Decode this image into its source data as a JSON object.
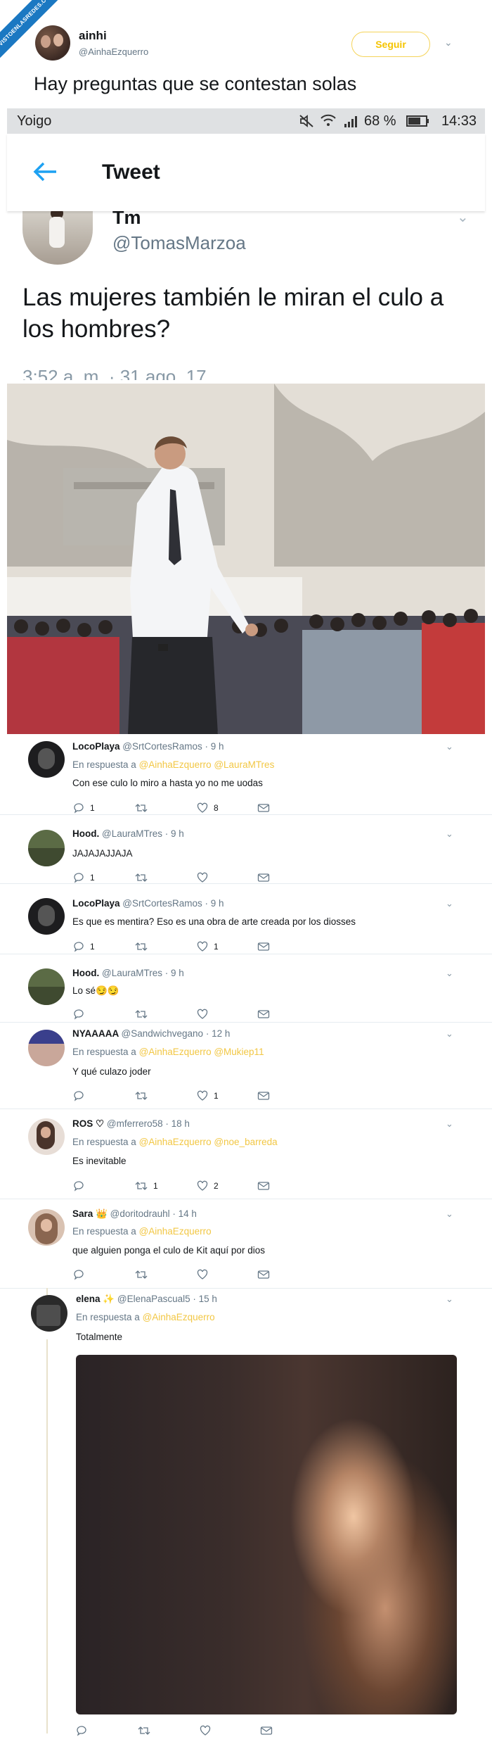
{
  "watermark": "VISTOENLASREDES.COM",
  "quote_tweet": {
    "name": "ainhi",
    "handle": "@AinhaEzquerro",
    "follow_label": "Seguir",
    "text": "Hay preguntas que se contestan solas"
  },
  "status_bar": {
    "carrier": "Yoigo",
    "battery": "68 %",
    "time": "14:33"
  },
  "app_bar": {
    "title": "Tweet"
  },
  "original_tweet": {
    "name": "Tm",
    "handle": "@TomasMarzoa",
    "text": "Las mujeres también le miran el culo a los hombres?",
    "date": "3:52 a. m. · 31 ago. 17"
  },
  "replies": [
    {
      "name": "LocoPlaya",
      "handle": "@SrtCortesRamos",
      "time": "· 9 h",
      "reply_prefix": "En respuesta a",
      "mentions": "@AinhaEzquerro @LauraMTres",
      "text": "Con ese culo lo miro a hasta yo no me uodas",
      "replies_count": "1",
      "retweets_count": "",
      "likes_count": "8",
      "avatar_color": "#1d1d1f"
    },
    {
      "name": "Hood.",
      "handle": "@LauraMTres",
      "time": "· 9 h",
      "reply_prefix": "",
      "mentions": "",
      "text": "JAJAJAJJAJA",
      "replies_count": "1",
      "retweets_count": "",
      "likes_count": "",
      "avatar_color": "#5b6b45"
    },
    {
      "name": "LocoPlaya",
      "handle": "@SrtCortesRamos",
      "time": "· 9 h",
      "reply_prefix": "",
      "mentions": "",
      "text": "Es que es mentira? Eso es una obra de arte creada por los diosses",
      "replies_count": "1",
      "retweets_count": "",
      "likes_count": "1",
      "avatar_color": "#1d1d1f"
    },
    {
      "name": "Hood.",
      "handle": "@LauraMTres",
      "time": "· 9 h",
      "reply_prefix": "",
      "mentions": "",
      "text": "Lo sé😏😏",
      "replies_count": "",
      "retweets_count": "",
      "likes_count": "",
      "avatar_color": "#5b6b45"
    },
    {
      "name": "NYAAAAA",
      "handle": "@Sandwichvegano",
      "time": "· 12 h",
      "reply_prefix": "En respuesta a",
      "mentions": "@AinhaEzquerro @Mukiep11",
      "text": "Y qué culazo joder",
      "replies_count": "",
      "retweets_count": "",
      "likes_count": "1",
      "avatar_color": "#c9a79a"
    },
    {
      "name": "ROS ♡",
      "handle": "@mferrero58",
      "time": "· 18 h",
      "reply_prefix": "En respuesta a",
      "mentions": "@AinhaEzquerro @noe_barreda",
      "text": "Es inevitable",
      "replies_count": "",
      "retweets_count": "1",
      "likes_count": "2",
      "avatar_color": "#7a5a50"
    },
    {
      "name": "Sara 👑",
      "handle": "@doritodrauhl",
      "time": "· 14 h",
      "reply_prefix": "En respuesta a",
      "mentions": "@AinhaEzquerro",
      "text": "que alguien ponga el culo de Kit aquí por dios",
      "replies_count": "",
      "retweets_count": "",
      "likes_count": "",
      "avatar_color": "#a08068"
    },
    {
      "name": "elena ✨",
      "handle": "@ElenaPascual5",
      "time": "· 15 h",
      "reply_prefix": "En respuesta a",
      "mentions": "@AinhaEzquerro",
      "text": "Totalmente",
      "replies_count": "",
      "retweets_count": "",
      "likes_count": "",
      "avatar_color": "#2a2a2a"
    }
  ]
}
